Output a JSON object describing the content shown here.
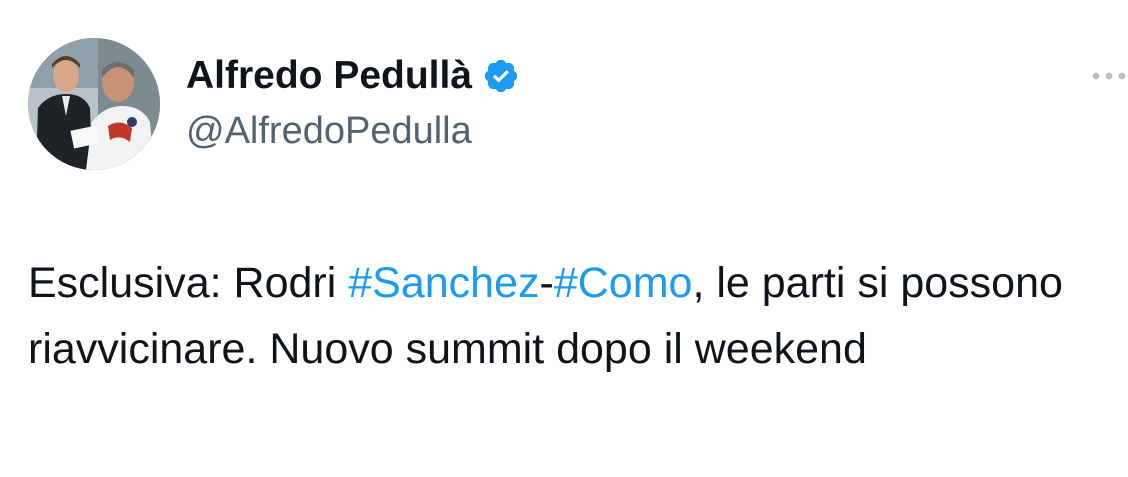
{
  "author": {
    "display_name": "Alfredo Pedullà",
    "handle": "@AlfredoPedulla",
    "verified_icon": "verified-badge-icon",
    "avatar": "avatar-photo"
  },
  "menu": {
    "icon": "more-options-icon"
  },
  "tweet": {
    "part1": "Esclusiva: Rodri ",
    "hashtag1": "#Sanchez",
    "sep": "-",
    "hashtag2": "#Como",
    "part2": ", le parti si possono riavvicinare. Nuovo summit dopo il weekend"
  },
  "colors": {
    "hashtag": "#1d9bf0",
    "handle": "#536471",
    "text": "#0f1419",
    "verified": "#1d9bf0"
  }
}
